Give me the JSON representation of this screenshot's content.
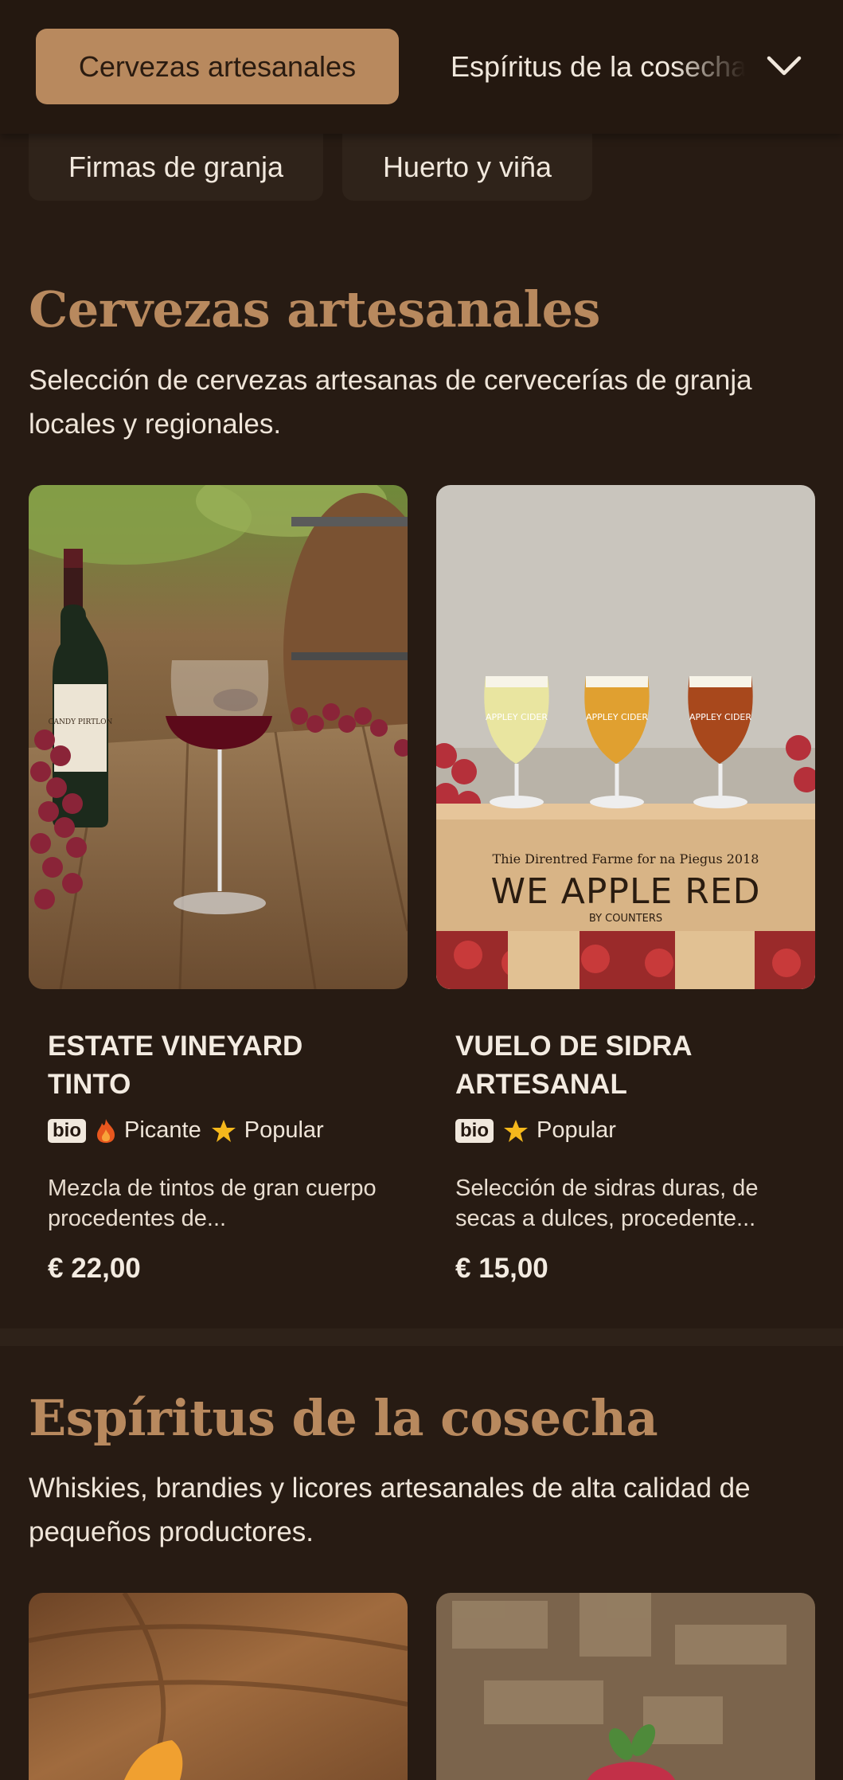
{
  "nav": {
    "active_tab": "Cervezas artesanales",
    "next_tab": "Espíritus de la cosecha",
    "sub_tabs": [
      "Firmas de granja",
      "Huerto y viña"
    ]
  },
  "sections": [
    {
      "title": "Cervezas artesanales",
      "description": "Selección de cervezas artesanas de cervecerías de granja locales y regionales.",
      "products": [
        {
          "name": "Estate Vineyard Tinto",
          "tags": {
            "bio": "bio",
            "spicy": "Picante",
            "popular": "Popular"
          },
          "description": "Mezcla de tintos de gran cuerpo procedentes de...",
          "price": "€ 22,00",
          "image_text": {
            "bottle_label": "CANDY PIRTLON"
          }
        },
        {
          "name": "Vuelo de sidra artesanal",
          "tags": {
            "bio": "bio",
            "popular": "Popular"
          },
          "description": "Selección de sidras duras, de secas a dulces, procedente...",
          "price": "€ 15,00",
          "image_text": {
            "glass_label": "APPLEY CIDER",
            "crate_top": "Thie Direntred Farme for na Piegus 2018",
            "crate_main": "WE APPLE RED",
            "crate_sub": "BY COUNTERS"
          }
        }
      ]
    },
    {
      "title": "Espíritus de la cosecha",
      "description": "Whiskies, brandies y licores artesanales de alta calidad de pequeños productores."
    }
  ],
  "colors": {
    "background": "#271b13",
    "accent": "#b8895e",
    "star": "#f5b81c",
    "flame": "#e8571e"
  }
}
